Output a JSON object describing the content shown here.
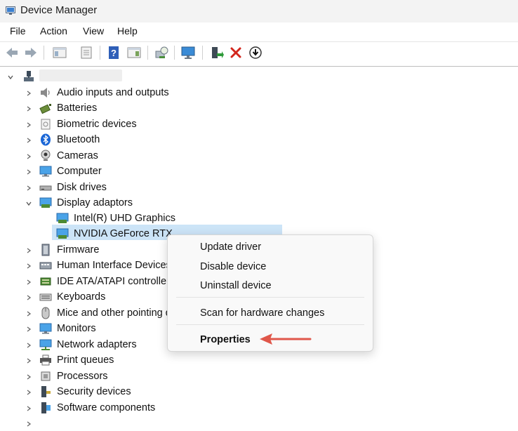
{
  "window": {
    "title": "Device Manager"
  },
  "menu": [
    "File",
    "Action",
    "View",
    "Help"
  ],
  "tree": {
    "categories": [
      {
        "label": "Audio inputs and outputs",
        "icon": "speaker-icon"
      },
      {
        "label": "Batteries",
        "icon": "battery-icon"
      },
      {
        "label": "Biometric devices",
        "icon": "biometric-icon"
      },
      {
        "label": "Bluetooth",
        "icon": "bluetooth-icon"
      },
      {
        "label": "Cameras",
        "icon": "camera-icon"
      },
      {
        "label": "Computer",
        "icon": "computer-icon"
      },
      {
        "label": "Disk drives",
        "icon": "disk-drive-icon"
      },
      {
        "label": "Display adaptors",
        "icon": "display-adapter-icon"
      },
      {
        "label": "Firmware",
        "icon": "firmware-icon"
      },
      {
        "label": "Human Interface Devices",
        "icon": "hid-icon"
      },
      {
        "label": "IDE ATA/ATAPI controllers",
        "icon": "ide-icon"
      },
      {
        "label": "Keyboards",
        "icon": "keyboard-icon"
      },
      {
        "label": "Mice and other pointing devices",
        "icon": "mouse-icon"
      },
      {
        "label": "Monitors",
        "icon": "monitor-icon"
      },
      {
        "label": "Network adapters",
        "icon": "network-icon"
      },
      {
        "label": "Print queues",
        "icon": "printer-icon"
      },
      {
        "label": "Processors",
        "icon": "processor-icon"
      },
      {
        "label": "Security devices",
        "icon": "security-icon"
      },
      {
        "label": "Software components",
        "icon": "software-icon"
      }
    ],
    "display_children": [
      "Intel(R) UHD Graphics",
      "NVIDIA GeForce RTX"
    ]
  },
  "context_menu": {
    "items": [
      "Update driver",
      "Disable device",
      "Uninstall device",
      "Scan for hardware changes",
      "Properties"
    ]
  },
  "colors": {
    "selection": "#cce4f7",
    "arrow": "#e0574a",
    "delete": "#d2261c"
  }
}
